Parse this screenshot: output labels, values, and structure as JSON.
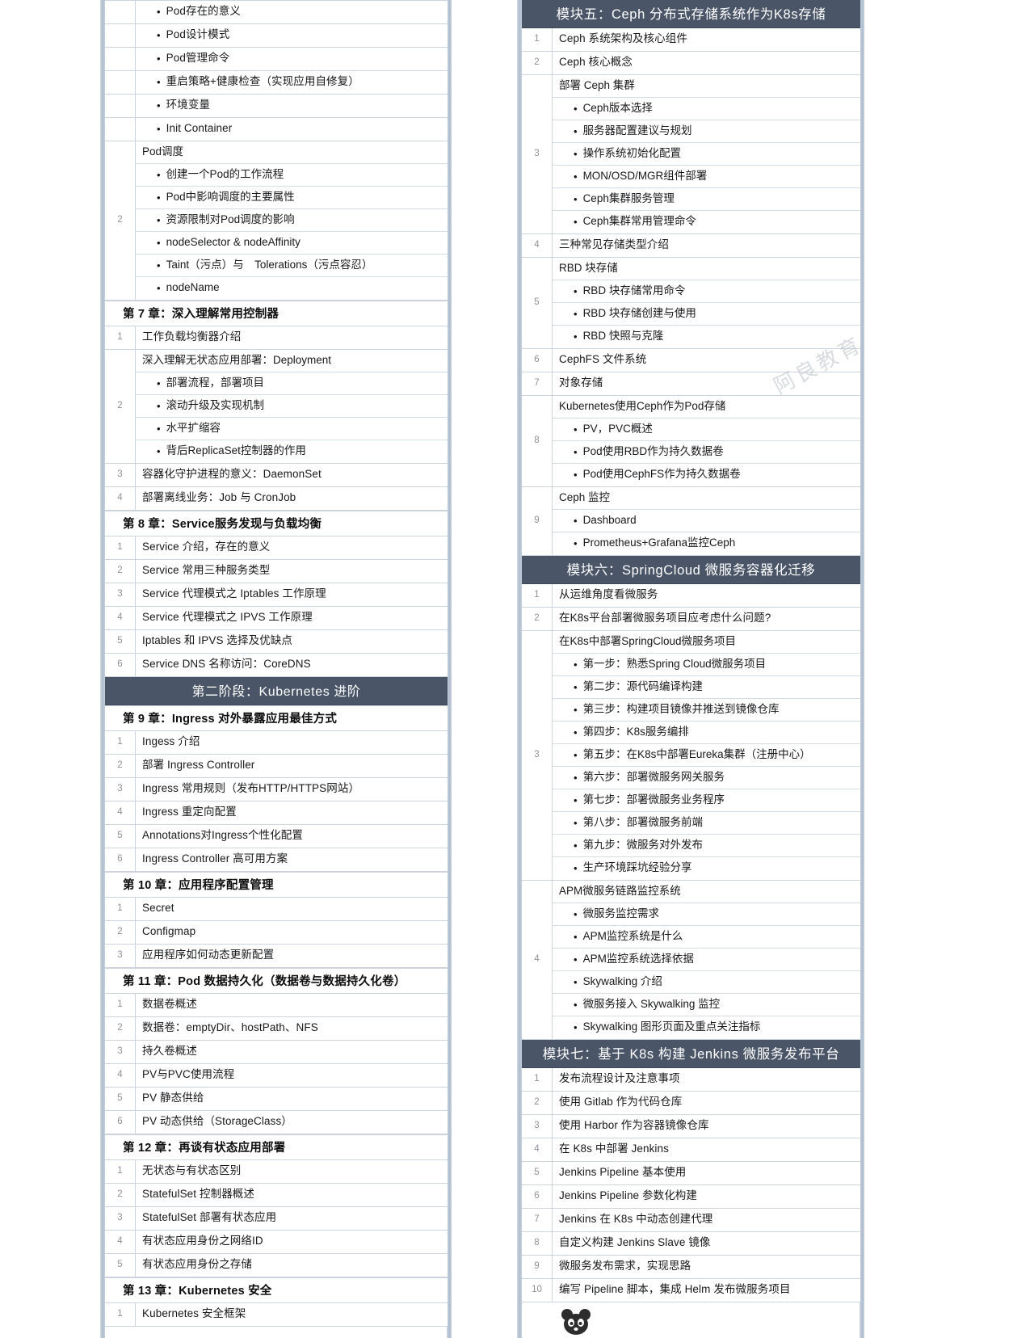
{
  "document": {
    "type": "course-syllabus-table",
    "watermark_text": "阿良教育",
    "colors": {
      "banner_bg": "#4a5568",
      "banner_text": "#ffffff",
      "grid_line": "#ccd3dd",
      "rail": "#aebccd",
      "number_text": "#8e9096",
      "body_text": "#17181a"
    }
  },
  "left_column": {
    "rows": [
      {
        "kind": "bullet",
        "num": "",
        "text": "Pod存在的意义"
      },
      {
        "kind": "bullet",
        "num": "",
        "text": "Pod设计模式"
      },
      {
        "kind": "bullet",
        "num": "",
        "text": "Pod管理命令"
      },
      {
        "kind": "bullet",
        "num": "",
        "text": "重启策略+健康检查（实现应用自修复）"
      },
      {
        "kind": "bullet",
        "num": "",
        "text": "环境变量"
      },
      {
        "kind": "bullet",
        "num": "",
        "text": "Init Container"
      },
      {
        "kind": "group",
        "num": "2",
        "items": [
          {
            "style": "head",
            "text": "Pod调度"
          },
          {
            "style": "bullet",
            "text": "创建一个Pod的工作流程"
          },
          {
            "style": "bullet",
            "text": "Pod中影响调度的主要属性"
          },
          {
            "style": "bullet",
            "text": "资源限制对Pod调度的影响"
          },
          {
            "style": "bullet",
            "text": "nodeSelector & nodeAffinity"
          },
          {
            "style": "bullet",
            "text": "Taint（污点）与　Tolerations（污点容忍）"
          },
          {
            "style": "bullet",
            "text": "nodeName"
          }
        ]
      },
      {
        "kind": "chapter",
        "text": "第 7 章：深入理解常用控制器"
      },
      {
        "kind": "row",
        "num": "1",
        "text": "工作负载均衡器介绍"
      },
      {
        "kind": "group",
        "num": "2",
        "items": [
          {
            "style": "head",
            "text": "深入理解无状态应用部署：Deployment"
          },
          {
            "style": "bullet",
            "text": "部署流程，部署项目"
          },
          {
            "style": "bullet",
            "text": "滚动升级及实现机制"
          },
          {
            "style": "bullet",
            "text": "水平扩缩容"
          },
          {
            "style": "bullet",
            "text": "背后ReplicaSet控制器的作用"
          }
        ]
      },
      {
        "kind": "row",
        "num": "3",
        "text": "容器化守护进程的意义：DaemonSet"
      },
      {
        "kind": "row",
        "num": "4",
        "text": "部署离线业务：Job 与 CronJob"
      },
      {
        "kind": "chapter",
        "text": "第 8 章：Service服务发现与负载均衡"
      },
      {
        "kind": "row",
        "num": "1",
        "text": "Service 介绍，存在的意义"
      },
      {
        "kind": "row",
        "num": "2",
        "text": "Service 常用三种服务类型"
      },
      {
        "kind": "row",
        "num": "3",
        "text": "Service 代理模式之 Iptables 工作原理"
      },
      {
        "kind": "row",
        "num": "4",
        "text": "Service 代理模式之 IPVS 工作原理"
      },
      {
        "kind": "row",
        "num": "5",
        "text": "Iptables 和 IPVS 选择及优缺点"
      },
      {
        "kind": "row",
        "num": "6",
        "text": "Service DNS 名称访问：CoreDNS"
      },
      {
        "kind": "banner",
        "text": "第二阶段：Kubernetes 进阶"
      },
      {
        "kind": "chapter",
        "text": "第 9 章：Ingress 对外暴露应用最佳方式"
      },
      {
        "kind": "row",
        "num": "1",
        "text": "Ingess 介绍"
      },
      {
        "kind": "row",
        "num": "2",
        "text": "部署 Ingress Controller"
      },
      {
        "kind": "row",
        "num": "3",
        "text": "Ingress 常用规则（发布HTTP/HTTPS网站）"
      },
      {
        "kind": "row",
        "num": "4",
        "text": "Ingress 重定向配置"
      },
      {
        "kind": "row",
        "num": "5",
        "text": "Annotations对Ingress个性化配置"
      },
      {
        "kind": "row",
        "num": "6",
        "text": "Ingress Controller 高可用方案"
      },
      {
        "kind": "chapter",
        "text": "第 10 章：应用程序配置管理"
      },
      {
        "kind": "row",
        "num": "1",
        "text": "Secret"
      },
      {
        "kind": "row",
        "num": "2",
        "text": "Configmap"
      },
      {
        "kind": "row",
        "num": "3",
        "text": "应用程序如何动态更新配置"
      },
      {
        "kind": "chapter",
        "text": "第 11 章：Pod 数据持久化（数据卷与数据持久化卷）"
      },
      {
        "kind": "row",
        "num": "1",
        "text": "数据卷概述"
      },
      {
        "kind": "row",
        "num": "2",
        "text": "数据卷：emptyDir、hostPath、NFS"
      },
      {
        "kind": "row",
        "num": "3",
        "text": "持久卷概述"
      },
      {
        "kind": "row",
        "num": "4",
        "text": "PV与PVC使用流程"
      },
      {
        "kind": "row",
        "num": "5",
        "text": "PV 静态供给"
      },
      {
        "kind": "row",
        "num": "6",
        "text": "PV 动态供给（StorageClass）"
      },
      {
        "kind": "chapter",
        "text": "第 12 章：再谈有状态应用部署"
      },
      {
        "kind": "row",
        "num": "1",
        "text": "无状态与有状态区别"
      },
      {
        "kind": "row",
        "num": "2",
        "text": "StatefulSet 控制器概述"
      },
      {
        "kind": "row",
        "num": "3",
        "text": "StatefulSet 部署有状态应用"
      },
      {
        "kind": "row",
        "num": "4",
        "text": "有状态应用身份之网络ID"
      },
      {
        "kind": "row",
        "num": "5",
        "text": "有状态应用身份之存储"
      },
      {
        "kind": "chapter",
        "text": "第 13 章：Kubernetes 安全"
      },
      {
        "kind": "row",
        "num": "1",
        "text": "Kubernetes 安全框架"
      }
    ]
  },
  "right_column": {
    "rows": [
      {
        "kind": "banner",
        "text": "模块五：Ceph 分布式存储系统作为K8s存储"
      },
      {
        "kind": "row",
        "num": "1",
        "text": "Ceph 系统架构及核心组件"
      },
      {
        "kind": "row",
        "num": "2",
        "text": "Ceph 核心概念"
      },
      {
        "kind": "group",
        "num": "3",
        "items": [
          {
            "style": "head",
            "text": "部署 Ceph 集群"
          },
          {
            "style": "bullet",
            "text": "Ceph版本选择"
          },
          {
            "style": "bullet",
            "text": "服务器配置建议与规划"
          },
          {
            "style": "bullet",
            "text": "操作系统初始化配置"
          },
          {
            "style": "bullet",
            "text": "MON/OSD/MGR组件部署"
          },
          {
            "style": "bullet",
            "text": "Ceph集群服务管理"
          },
          {
            "style": "bullet",
            "text": "Ceph集群常用管理命令"
          }
        ]
      },
      {
        "kind": "row",
        "num": "4",
        "text": "三种常见存储类型介绍"
      },
      {
        "kind": "group",
        "num": "5",
        "items": [
          {
            "style": "head",
            "text": "RBD 块存储"
          },
          {
            "style": "bullet",
            "text": "RBD 块存储常用命令"
          },
          {
            "style": "bullet",
            "text": "RBD 块存储创建与使用"
          },
          {
            "style": "bullet",
            "text": "RBD 快照与克隆"
          }
        ]
      },
      {
        "kind": "row",
        "num": "6",
        "text": "CephFS 文件系统"
      },
      {
        "kind": "row",
        "num": "7",
        "text": "对象存储"
      },
      {
        "kind": "group",
        "num": "8",
        "items": [
          {
            "style": "head",
            "text": "Kubernetes使用Ceph作为Pod存储"
          },
          {
            "style": "bullet",
            "text": "PV，PVC概述"
          },
          {
            "style": "bullet",
            "text": "Pod使用RBD作为持久数据卷"
          },
          {
            "style": "bullet",
            "text": "Pod使用CephFS作为持久数据卷"
          }
        ]
      },
      {
        "kind": "group",
        "num": "9",
        "items": [
          {
            "style": "head",
            "text": "Ceph 监控"
          },
          {
            "style": "bullet",
            "text": "Dashboard"
          },
          {
            "style": "bullet",
            "text": "Prometheus+Grafana监控Ceph"
          }
        ]
      },
      {
        "kind": "banner",
        "text": "模块六：SpringCloud 微服务容器化迁移"
      },
      {
        "kind": "row",
        "num": "1",
        "text": "从运维角度看微服务"
      },
      {
        "kind": "row",
        "num": "2",
        "text": "在K8s平台部署微服务项目应考虑什么问题?"
      },
      {
        "kind": "group",
        "num": "3",
        "items": [
          {
            "style": "head",
            "text": "在K8s中部署SpringCloud微服务项目"
          },
          {
            "style": "bullet",
            "text": "第一步：熟悉Spring Cloud微服务项目"
          },
          {
            "style": "bullet",
            "text": "第二步：源代码编译构建"
          },
          {
            "style": "bullet",
            "text": "第三步：构建项目镜像并推送到镜像仓库"
          },
          {
            "style": "bullet",
            "text": "第四步：K8s服务编排"
          },
          {
            "style": "bullet",
            "text": "第五步：在K8s中部署Eureka集群（注册中心）"
          },
          {
            "style": "bullet",
            "text": "第六步：部署微服务网关服务"
          },
          {
            "style": "bullet",
            "text": "第七步：部署微服务业务程序"
          },
          {
            "style": "bullet",
            "text": "第八步：部署微服务前端"
          },
          {
            "style": "bullet",
            "text": "第九步：微服务对外发布"
          },
          {
            "style": "bullet",
            "text": "生产环境踩坑经验分享"
          }
        ]
      },
      {
        "kind": "group",
        "num": "4",
        "items": [
          {
            "style": "head",
            "text": "APM微服务链路监控系统"
          },
          {
            "style": "bullet",
            "text": "微服务监控需求"
          },
          {
            "style": "bullet",
            "text": "APM监控系统是什么"
          },
          {
            "style": "bullet",
            "text": "APM监控系统选择依据"
          },
          {
            "style": "bullet",
            "text": "Skywalking 介绍"
          },
          {
            "style": "bullet",
            "text": "微服务接入 Skywalking 监控"
          },
          {
            "style": "bullet",
            "text": "Skywalking 图形页面及重点关注指标"
          }
        ]
      },
      {
        "kind": "banner",
        "text": "模块七：基于 K8s 构建 Jenkins 微服务发布平台"
      },
      {
        "kind": "row",
        "num": "1",
        "text": "发布流程设计及注意事项"
      },
      {
        "kind": "row",
        "num": "2",
        "text": "使用 Gitlab 作为代码仓库"
      },
      {
        "kind": "row",
        "num": "3",
        "text": "使用 Harbor 作为容器镜像仓库"
      },
      {
        "kind": "row",
        "num": "4",
        "text": "在 K8s 中部署 Jenkins"
      },
      {
        "kind": "row",
        "num": "5",
        "text": "Jenkins Pipeline 基本使用"
      },
      {
        "kind": "row",
        "num": "6",
        "text": "Jenkins Pipeline 参数化构建"
      },
      {
        "kind": "row",
        "num": "7",
        "text": "Jenkins 在 K8s 中动态创建代理"
      },
      {
        "kind": "row",
        "num": "8",
        "text": "自定义构建 Jenkins Slave 镜像"
      },
      {
        "kind": "row",
        "num": "9",
        "text": "微服务发布需求，实现思路"
      },
      {
        "kind": "row",
        "num": "10",
        "text": "编写 Pipeline 脚本，集成 Helm 发布微服务项目"
      }
    ]
  }
}
